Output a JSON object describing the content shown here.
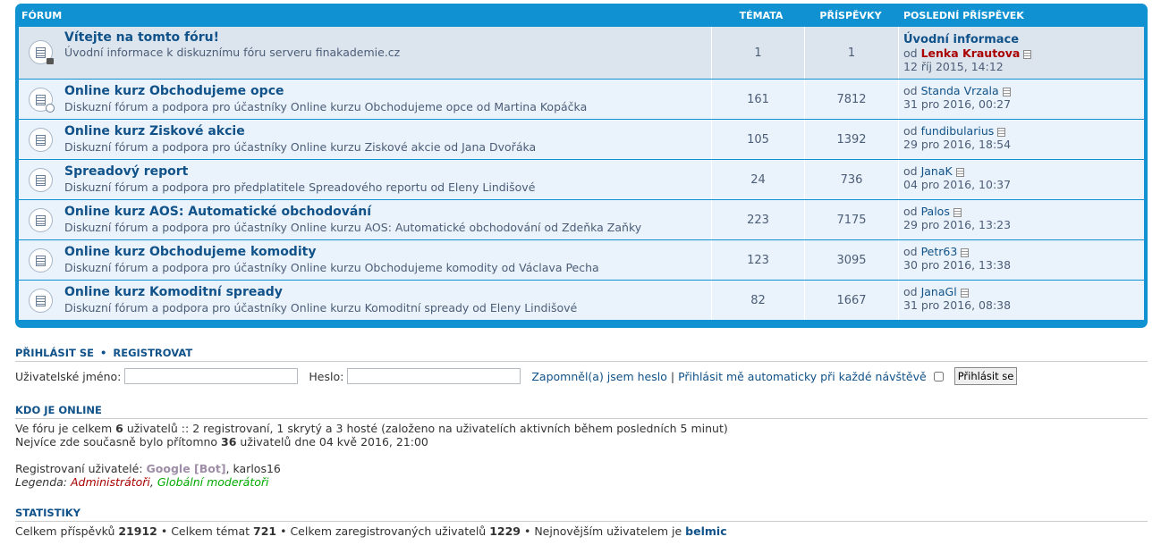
{
  "header": {
    "forum": "Fórum",
    "topics": "Témata",
    "posts": "Příspěvky",
    "last_post": "Poslední příspěvek"
  },
  "forums": [
    {
      "title": "Vítejte na tomto fóru!",
      "desc": "Úvodní informace k diskuznímu fóru serveru finakademie.cz",
      "topics": "1",
      "posts": "1",
      "last_title": "Úvodní informace",
      "by": "od",
      "author": "Lenka Krautova",
      "author_admin": true,
      "date": "12 říj 2015, 14:12",
      "icon": "locked-forum-icon"
    },
    {
      "title": "Online kurz Obchodujeme opce",
      "desc": "Diskuzní fórum a podpora pro účastníky Online kurzu Obchodujeme opce od Martina Kopáčka",
      "topics": "161",
      "posts": "7812",
      "by": "od",
      "author": "Standa Vrzala",
      "date": "31 pro 2016, 00:27",
      "icon": "forum-subforum-icon"
    },
    {
      "title": "Online kurz Ziskové akcie",
      "desc": "Diskuzní fórum a podpora pro účastníky Online kurzu Ziskové akcie od Jana Dvořáka",
      "topics": "105",
      "posts": "1392",
      "by": "od",
      "author": "fundibularius",
      "date": "29 pro 2016, 18:54",
      "icon": "forum-icon"
    },
    {
      "title": "Spreadový report",
      "desc": "Diskuzní fórum a podpora pro předplatitele Spreadového reportu od Eleny Lindišové",
      "topics": "24",
      "posts": "736",
      "by": "od",
      "author": "JanaK",
      "date": "04 pro 2016, 10:37",
      "icon": "forum-icon"
    },
    {
      "title": "Online kurz AOS: Automatické obchodování",
      "desc": "Diskuzní fórum a podpora pro účastníky Online kurzu AOS: Automatické obchodování od Zdeňka Zaňky",
      "topics": "223",
      "posts": "7175",
      "by": "od",
      "author": "Palos",
      "date": "29 pro 2016, 13:23",
      "icon": "forum-icon"
    },
    {
      "title": "Online kurz Obchodujeme komodity",
      "desc": "Diskuzní fórum a podpora pro účastníky Online kurzu Obchodujeme komodity od Václava Pecha",
      "topics": "123",
      "posts": "3095",
      "by": "od",
      "author": "Petr63",
      "date": "30 pro 2016, 13:38",
      "icon": "forum-icon"
    },
    {
      "title": "Online kurz Komoditní spready",
      "desc": "Diskuzní fórum a podpora pro účastníky Online kurzu Komoditní spready od Eleny Lindišové",
      "topics": "82",
      "posts": "1667",
      "by": "od",
      "author": "JanaGl",
      "date": "31 pro 2016, 08:38",
      "icon": "forum-icon"
    }
  ],
  "login": {
    "login_link": "Přihlásit se",
    "separator": "•",
    "register_link": "Registrovat",
    "username_label": "Uživatelské jméno:",
    "username_value": "",
    "password_label": "Heslo:",
    "password_value": "",
    "forgot": "Zapomněl(a) jsem heslo",
    "pipe": "|",
    "auto": "Přihlásit mě automaticky při každé návštěvě",
    "auto_checked": false,
    "submit": "Přihlásit se"
  },
  "online": {
    "heading": "Kdo je online",
    "line1_pre": "Ve fóru je celkem ",
    "line1_count": "6",
    "line1_post": " uživatelů :: 2 registrovaní, 1 skrytý a 3 hosté (založeno na uživatelích aktivních během posledních 5 minut)",
    "line2_pre": "Nejvíce zde současně bylo přítomno ",
    "line2_count": "36",
    "line2_post": " uživatelů dne 04 kvě 2016, 21:00",
    "registered_label": "Registrovaní uživatelé: ",
    "bot": "Google [Bot]",
    "comma": ", ",
    "user": "karlos16",
    "legend_label": "Legenda: ",
    "legend_admin": "Administrátoři",
    "legend_comma": ", ",
    "legend_mod": "Globální moderátoři"
  },
  "stats": {
    "heading": "Statistiky",
    "posts_label": "Celkem příspěvků ",
    "posts": "21912",
    "sep1": " • ",
    "topics_label": "Celkem témat ",
    "topics": "721",
    "sep2": " • ",
    "users_label": "Celkem zaregistrovaných uživatelů ",
    "users": "1229",
    "sep3": " • ",
    "newest_label": "Nejnovějším uživatelem je ",
    "newest": "belmic"
  },
  "colors": {
    "header_blue": "#0f91d2",
    "row_bg": "#eaf3fb",
    "link": "#105289",
    "admin": "#aa0000",
    "mod": "#00aa00"
  }
}
